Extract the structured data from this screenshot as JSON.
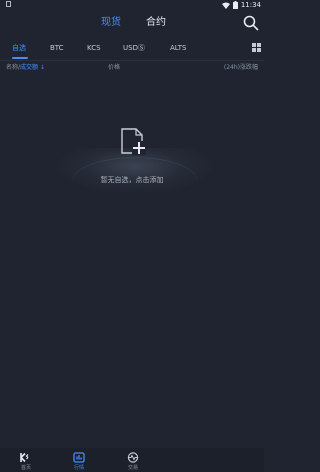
{
  "status_bar": {
    "time": "11:34"
  },
  "header": {
    "tabs": [
      {
        "label": "现货",
        "active": true
      },
      {
        "label": "合约",
        "active": false
      }
    ]
  },
  "market_tabs": [
    {
      "label": "自选",
      "active": true
    },
    {
      "label": "BTC",
      "active": false
    },
    {
      "label": "KCS",
      "active": false
    },
    {
      "label": "USDⓈ",
      "active": false
    },
    {
      "label": "ALTS",
      "active": false
    }
  ],
  "columns": {
    "name": "名称/",
    "volume": "成交额",
    "sort_arrow": "↓",
    "price": "价格",
    "change": "(24h)涨跌幅"
  },
  "empty_state": {
    "message": "暂无自选，点击添加",
    "icon": "add-favorite-icon"
  },
  "bottom_nav": [
    {
      "label": "首页",
      "icon": "home-logo-icon",
      "active": false
    },
    {
      "label": "行情",
      "icon": "market-chart-icon",
      "active": true
    },
    {
      "label": "交易",
      "icon": "trade-icon",
      "active": false
    }
  ],
  "colors": {
    "background": "#1f2430",
    "accent": "#4a8cf7",
    "text_muted": "#8a93a3"
  }
}
